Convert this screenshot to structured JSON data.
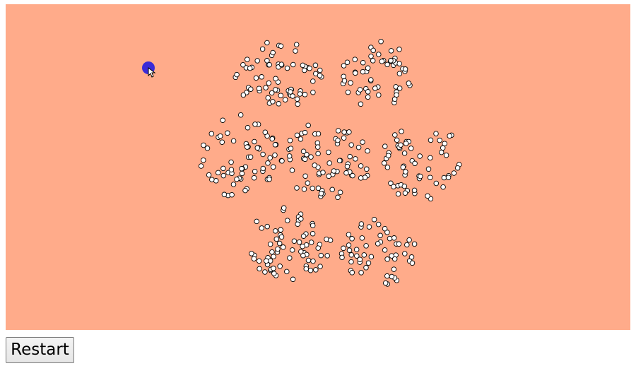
{
  "game": {
    "background_color": "#FFAB8A",
    "particle_color": "#FFFFFF",
    "particle_stroke": "#000000",
    "player_color": "#3A2BD6",
    "cursor_icon": "mouse-pointer-icon",
    "particle_icon": "white-dot-icon",
    "player_icon": "blue-ball-icon"
  },
  "controls": {
    "restart_label": "Restart"
  }
}
